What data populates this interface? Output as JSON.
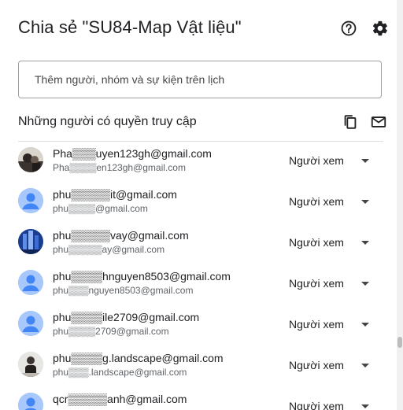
{
  "dialog": {
    "title": "Chia sẻ \"SU84-Map Vật liệu\"",
    "help_icon": "help-circle-icon",
    "settings_icon": "gear-icon"
  },
  "add_people": {
    "placeholder": "Thêm người, nhóm và sự kiện trên lịch"
  },
  "access_section": {
    "title": "Những người có quyền truy cập",
    "copy_icon": "copy-emails-icon",
    "mail_icon": "email-icon"
  },
  "people": [
    {
      "email": "Pha▒▒▒uyen123gh@gmail.com",
      "sub": "Pha▒▒▒▒en123gh@gmail.com",
      "role": "Người xem",
      "avatar": "photo-dark"
    },
    {
      "email": "phu▒▒▒▒▒it@gmail.com",
      "sub": "phu▒▒▒▒@gmail.com",
      "role": "Người xem",
      "avatar": "default-person"
    },
    {
      "email": "phu▒▒▒▒▒vay@gmail.com",
      "sub": "phu▒▒▒▒▒ay@gmail.com",
      "role": "Người xem",
      "avatar": "photo-blue"
    },
    {
      "email": "phu▒▒▒▒hnguyen8503@gmail.com",
      "sub": "phu▒▒▒nguyen8503@gmail.com",
      "role": "Người xem",
      "avatar": "default-person"
    },
    {
      "email": "phu▒▒▒▒ile2709@gmail.com",
      "sub": "phu▒▒▒▒2709@gmail.com",
      "role": "Người xem",
      "avatar": "default-person"
    },
    {
      "email": "phu▒▒▒▒g.landscape@gmail.com",
      "sub": "phu▒▒▒.landscape@gmail.com",
      "role": "Người xem",
      "avatar": "photo-light"
    },
    {
      "email": "qcr▒▒▒▒▒anh@gmail.com",
      "sub": "",
      "role": "Người xem",
      "avatar": "default-person"
    }
  ]
}
